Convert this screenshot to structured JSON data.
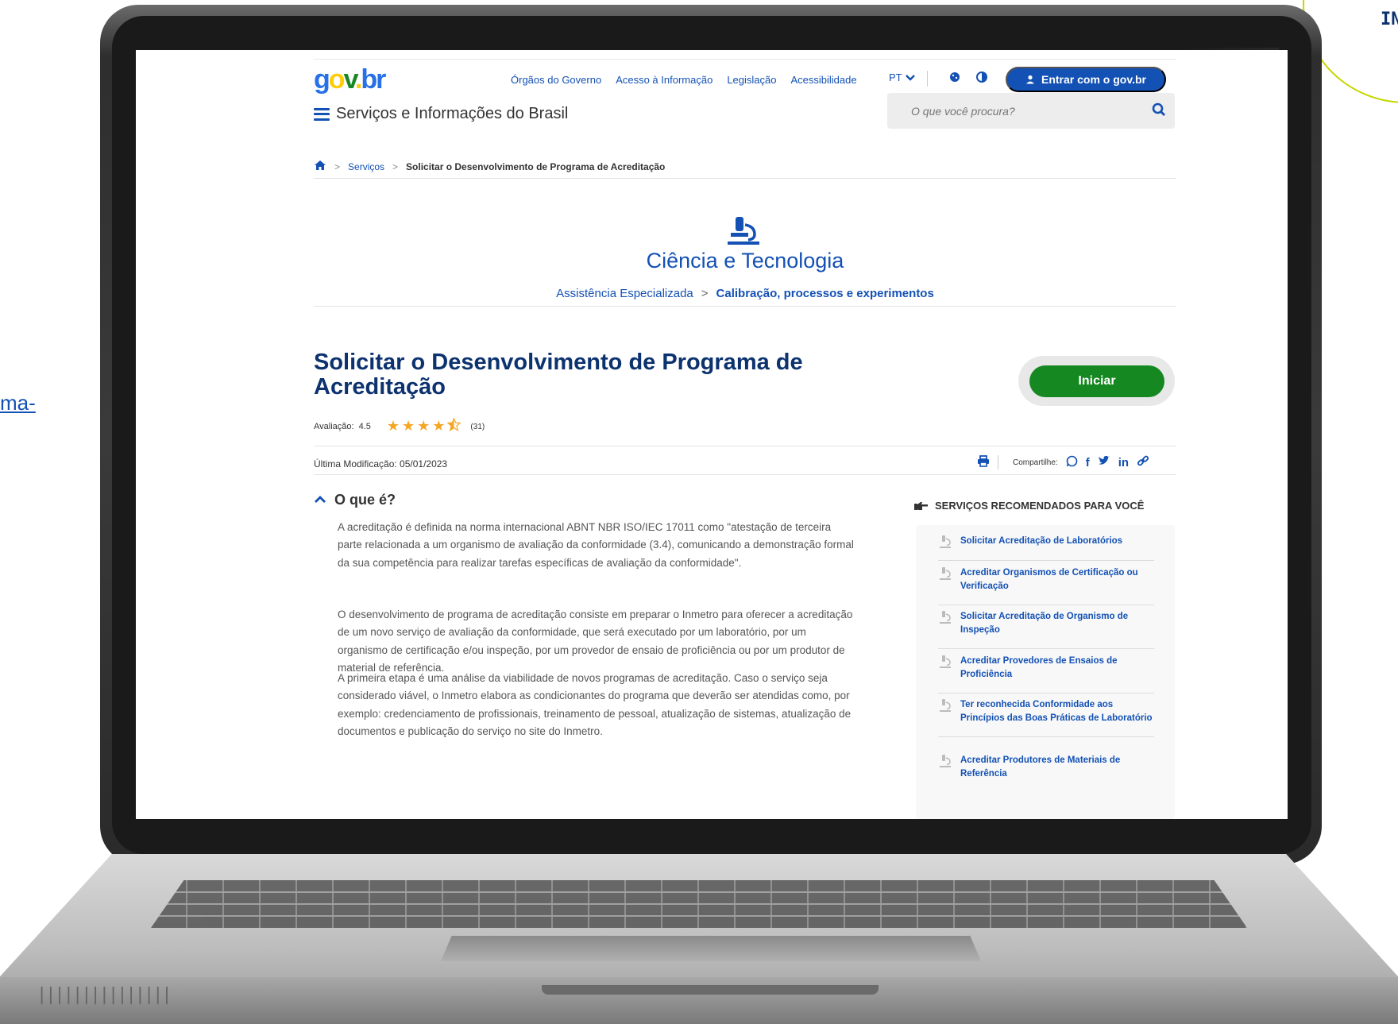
{
  "side_link_text": "ma-",
  "corner_text": "IN",
  "header": {
    "logo": {
      "g": "g",
      "o": "o",
      "v": "v",
      "dot": ".",
      "br": "br"
    },
    "links": [
      "Órgãos do Governo",
      "Acesso à Informação",
      "Legislação",
      "Acessibilidade"
    ],
    "language": "PT",
    "login_label": "Entrar com o gov.br",
    "site_title": "Serviços e Informações do Brasil",
    "search_placeholder": "O que você procura?"
  },
  "breadcrumb": {
    "services": "Serviços",
    "current": "Solicitar o Desenvolvimento de Programa de Acreditação"
  },
  "category": {
    "title": "Ciência e Tecnologia",
    "sub1": "Assistência Especializada",
    "sep": ">",
    "sub2": "Calibração, processos e experimentos"
  },
  "service": {
    "title": "Solicitar o Desenvolvimento de Programa de Acreditação",
    "start_label": "Iniciar",
    "rating_label": "Avaliação:",
    "rating_value": "4.5",
    "rating_stars": 4.5,
    "rating_count": "(31)",
    "last_modified": "Última Modificação: 05/01/2023",
    "share_label": "Compartilhe:"
  },
  "section": {
    "title": "O que é?",
    "p1": "A acreditação é definida na norma internacional ABNT NBR ISO/IEC 17011 como \"atestação de terceira parte relacionada a um organismo de avaliação da conformidade (3.4), comunicando a demonstração formal da sua competência para realizar tarefas específicas de avaliação da conformidade\".",
    "p2": "O desenvolvimento de programa de acreditação consiste em preparar o Inmetro para oferecer a acreditação de um novo serviço de avaliação da conformidade, que será executado por um laboratório, por um organismo de certificação e/ou inspeção, por um provedor de ensaio de proficiência ou por um produtor de material de referência.",
    "p3": "A primeira etapa é uma análise da viabilidade de novos programas de acreditação. Caso o serviço seja considerado viável, o Inmetro elabora as condicionantes do programa que deverão ser atendidas como, por exemplo: credenciamento de profissionais, treinamento de pessoal, atualização de sistemas, atualização de documentos e publicação do serviço no site do Inmetro."
  },
  "recommended": {
    "title": "SERVIÇOS RECOMENDADOS PARA VOCÊ",
    "items": [
      "Solicitar Acreditação de Laboratórios",
      "Acreditar Organismos de Certificação ou Verificação",
      "Solicitar Acreditação de Organismo de Inspeção",
      "Acreditar Provedores de Ensaios de Proficiência",
      "Ter reconhecida Conformidade aos Princípios das Boas Práticas de Laboratório",
      "Acreditar Produtores de Materiais de Referência"
    ]
  },
  "colors": {
    "primary_blue": "#1351b4",
    "dark_blue": "#0c326f",
    "green": "#168821",
    "star": "#f5a623"
  }
}
